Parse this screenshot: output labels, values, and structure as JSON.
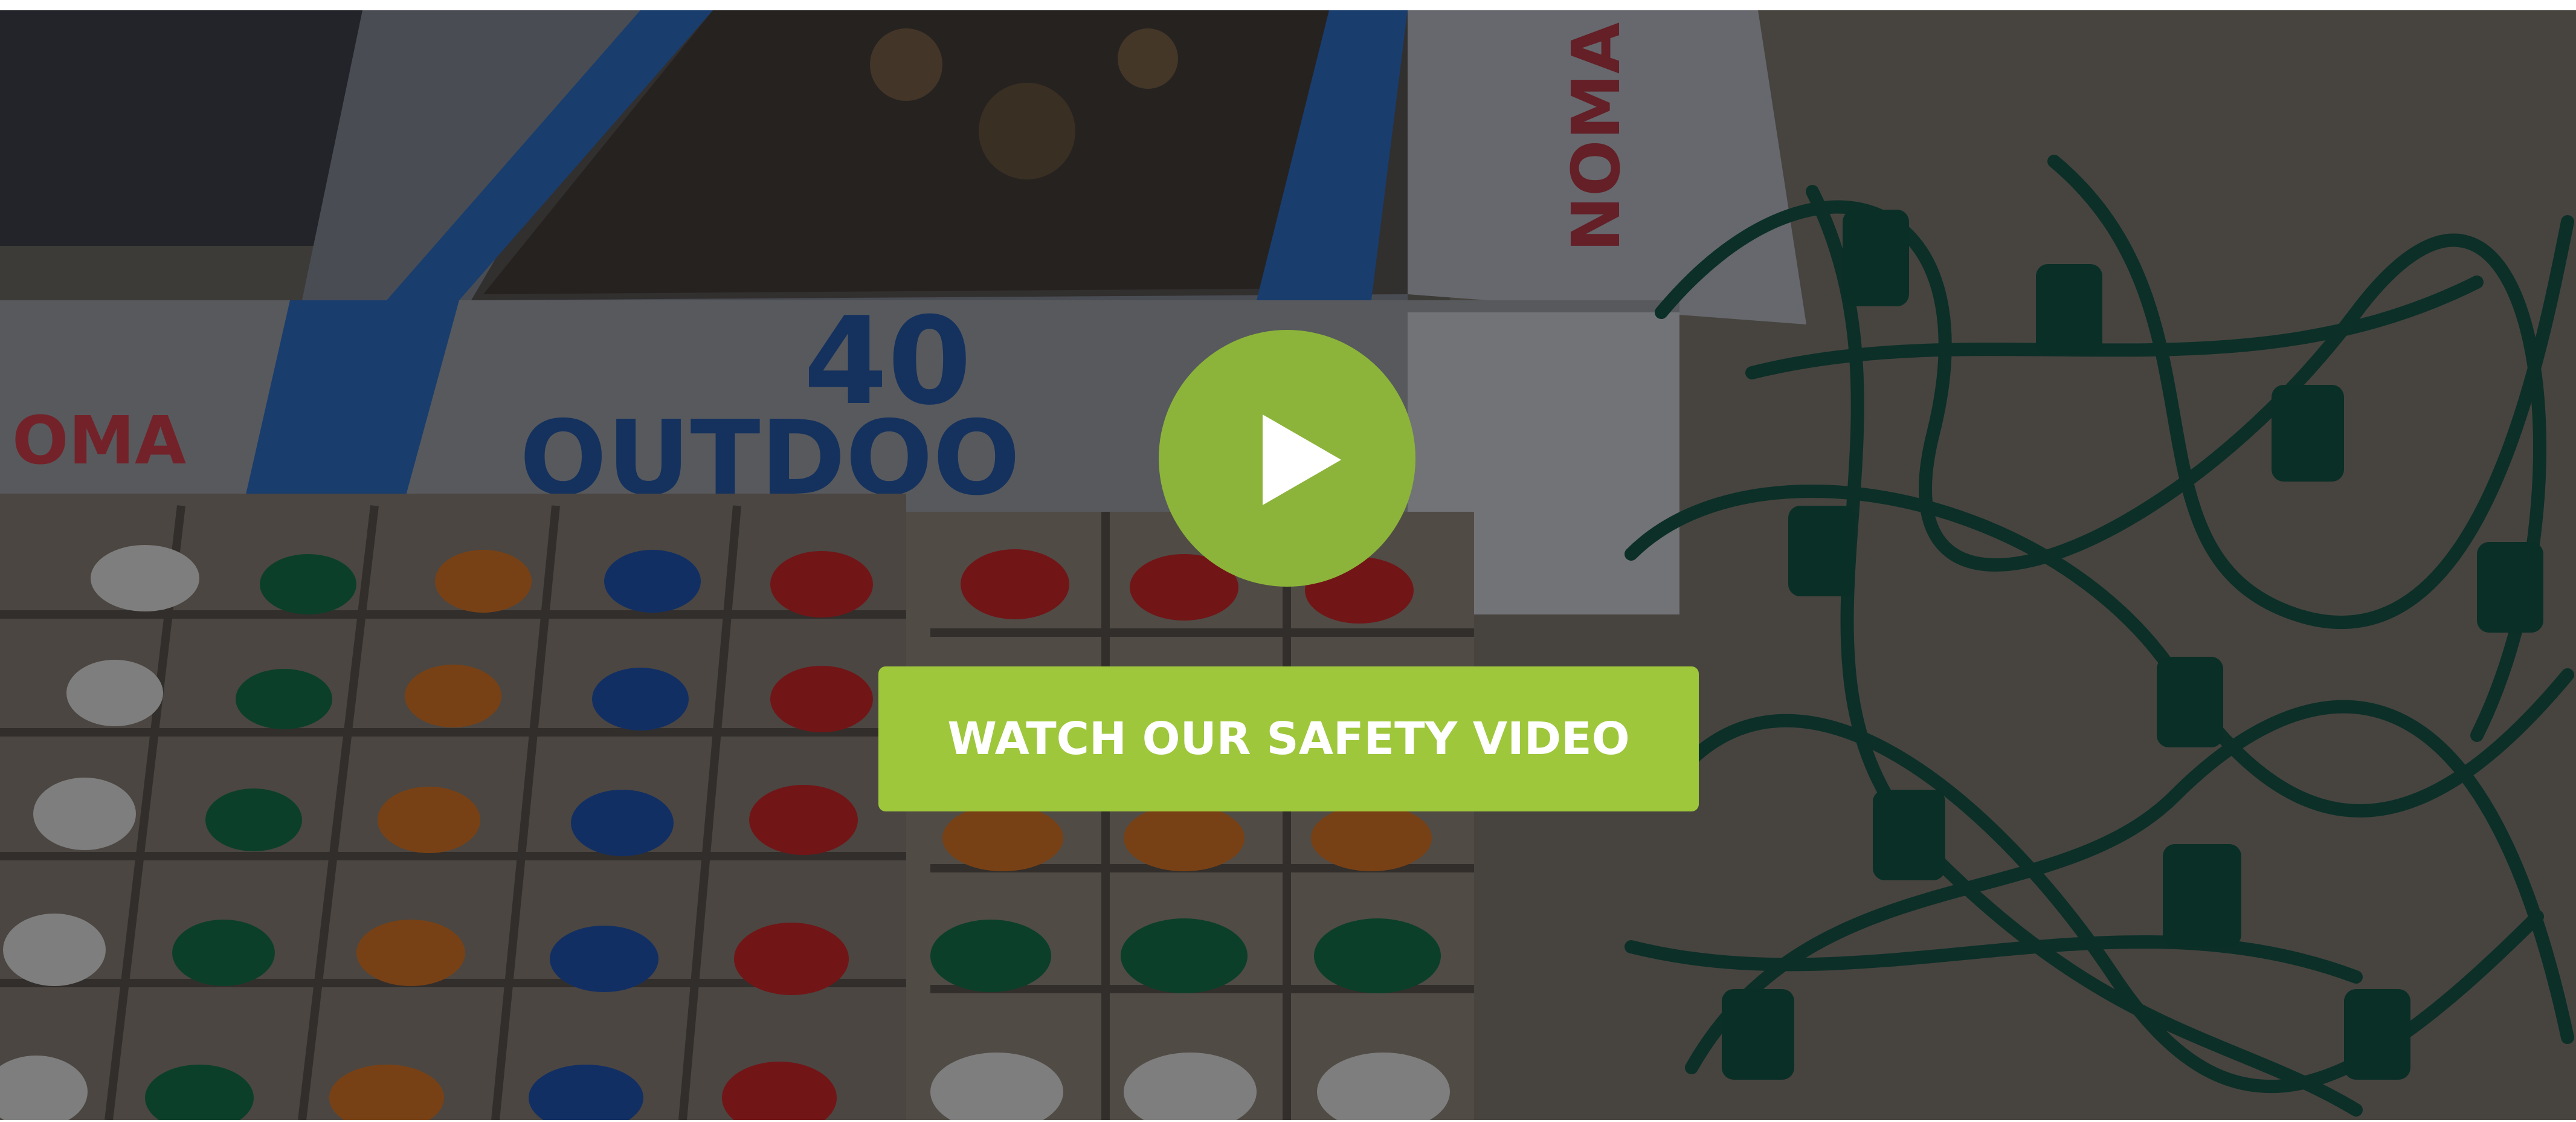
{
  "hero": {
    "background_image": "christmas-light-bulbs-photo",
    "box_brand": "NOMA",
    "box_count": "40",
    "box_text": "OUTDOOR"
  },
  "play_button": {
    "icon": "play-icon",
    "color": "#8cb43a"
  },
  "cta": {
    "label": "WATCH OUR SAFETY VIDEO",
    "color": "#9ec73c"
  }
}
